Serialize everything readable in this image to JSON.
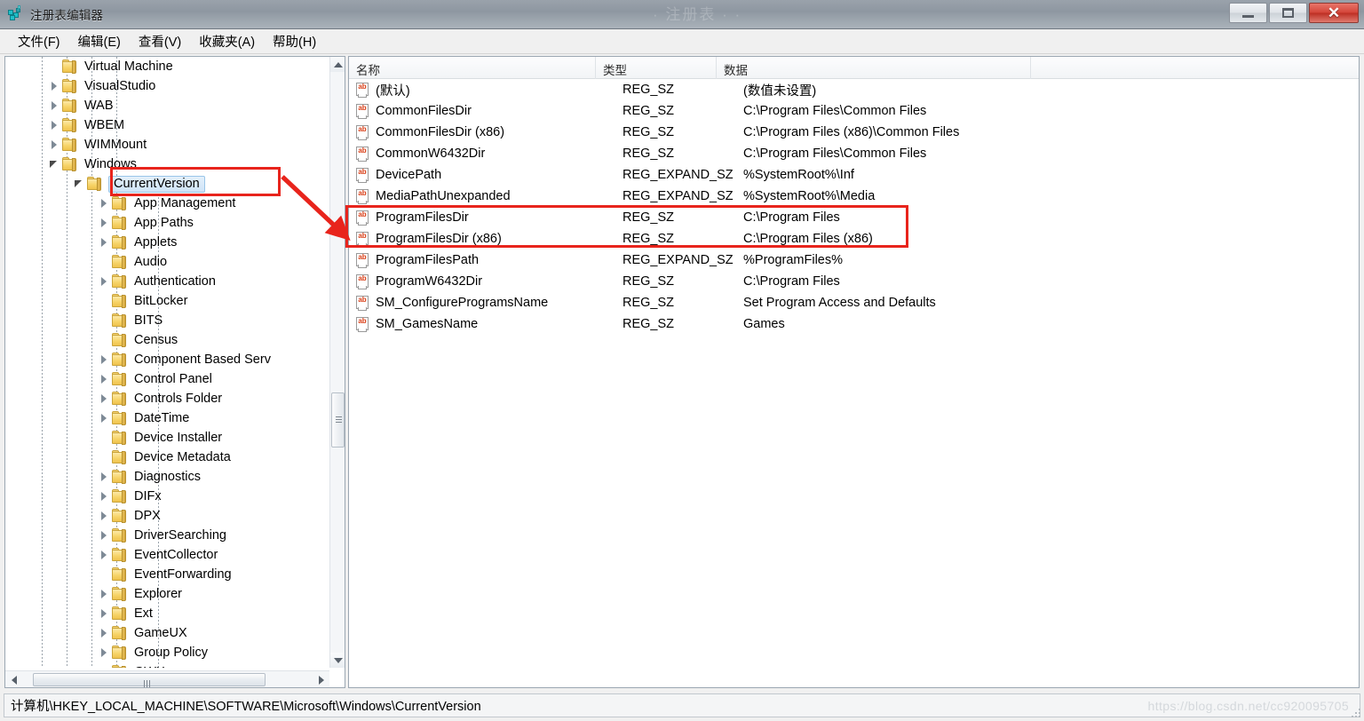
{
  "window": {
    "title": "注册表编辑器",
    "icon": "registry-editor-icon",
    "minimize_label": "",
    "maximize_label": "",
    "close_label": "✕",
    "title_watermark": "· 注册表 · ·"
  },
  "menubar": {
    "items": [
      {
        "label": "文件(F)",
        "name": "menu-file"
      },
      {
        "label": "编辑(E)",
        "name": "menu-edit"
      },
      {
        "label": "查看(V)",
        "name": "menu-view"
      },
      {
        "label": "收藏夹(A)",
        "name": "menu-favorites"
      },
      {
        "label": "帮助(H)",
        "name": "menu-help"
      }
    ]
  },
  "tree": {
    "nodes": [
      {
        "label": "Virtual Machine",
        "indent": 3,
        "expander": "none",
        "selected": false
      },
      {
        "label": "VisualStudio",
        "indent": 3,
        "expander": "collapsed",
        "selected": false
      },
      {
        "label": "WAB",
        "indent": 3,
        "expander": "collapsed",
        "selected": false
      },
      {
        "label": "WBEM",
        "indent": 3,
        "expander": "collapsed",
        "selected": false
      },
      {
        "label": "WIMMount",
        "indent": 3,
        "expander": "collapsed",
        "selected": false
      },
      {
        "label": "Windows",
        "indent": 3,
        "expander": "expanded",
        "selected": false
      },
      {
        "label": "CurrentVersion",
        "indent": 4,
        "expander": "expanded",
        "selected": true
      },
      {
        "label": "App Management",
        "indent": 5,
        "expander": "collapsed",
        "selected": false
      },
      {
        "label": "App Paths",
        "indent": 5,
        "expander": "collapsed",
        "selected": false
      },
      {
        "label": "Applets",
        "indent": 5,
        "expander": "collapsed",
        "selected": false
      },
      {
        "label": "Audio",
        "indent": 5,
        "expander": "none",
        "selected": false
      },
      {
        "label": "Authentication",
        "indent": 5,
        "expander": "collapsed",
        "selected": false
      },
      {
        "label": "BitLocker",
        "indent": 5,
        "expander": "none",
        "selected": false
      },
      {
        "label": "BITS",
        "indent": 5,
        "expander": "none",
        "selected": false
      },
      {
        "label": "Census",
        "indent": 5,
        "expander": "none",
        "selected": false
      },
      {
        "label": "Component Based Serv",
        "indent": 5,
        "expander": "collapsed",
        "selected": false
      },
      {
        "label": "Control Panel",
        "indent": 5,
        "expander": "collapsed",
        "selected": false
      },
      {
        "label": "Controls Folder",
        "indent": 5,
        "expander": "collapsed",
        "selected": false
      },
      {
        "label": "DateTime",
        "indent": 5,
        "expander": "collapsed",
        "selected": false
      },
      {
        "label": "Device Installer",
        "indent": 5,
        "expander": "none",
        "selected": false
      },
      {
        "label": "Device Metadata",
        "indent": 5,
        "expander": "none",
        "selected": false
      },
      {
        "label": "Diagnostics",
        "indent": 5,
        "expander": "collapsed",
        "selected": false
      },
      {
        "label": "DIFx",
        "indent": 5,
        "expander": "collapsed",
        "selected": false
      },
      {
        "label": "DPX",
        "indent": 5,
        "expander": "collapsed",
        "selected": false
      },
      {
        "label": "DriverSearching",
        "indent": 5,
        "expander": "collapsed",
        "selected": false
      },
      {
        "label": "EventCollector",
        "indent": 5,
        "expander": "collapsed",
        "selected": false
      },
      {
        "label": "EventForwarding",
        "indent": 5,
        "expander": "none",
        "selected": false
      },
      {
        "label": "Explorer",
        "indent": 5,
        "expander": "collapsed",
        "selected": false
      },
      {
        "label": "Ext",
        "indent": 5,
        "expander": "collapsed",
        "selected": false
      },
      {
        "label": "GameUX",
        "indent": 5,
        "expander": "collapsed",
        "selected": false
      },
      {
        "label": "Group Policy",
        "indent": 5,
        "expander": "collapsed",
        "selected": false
      },
      {
        "label": "GWX",
        "indent": 5,
        "expander": "none",
        "selected": false
      }
    ]
  },
  "list": {
    "columns": [
      {
        "label": "名称",
        "name": "column-name"
      },
      {
        "label": "类型",
        "name": "column-type"
      },
      {
        "label": "数据",
        "name": "column-data"
      }
    ],
    "rows": [
      {
        "name": "(默认)",
        "type": "REG_SZ",
        "data": "(数值未设置)",
        "highlighted": false
      },
      {
        "name": "CommonFilesDir",
        "type": "REG_SZ",
        "data": "C:\\Program Files\\Common Files",
        "highlighted": false
      },
      {
        "name": "CommonFilesDir (x86)",
        "type": "REG_SZ",
        "data": "C:\\Program Files (x86)\\Common Files",
        "highlighted": false
      },
      {
        "name": "CommonW6432Dir",
        "type": "REG_SZ",
        "data": "C:\\Program Files\\Common Files",
        "highlighted": false
      },
      {
        "name": "DevicePath",
        "type": "REG_EXPAND_SZ",
        "data": "%SystemRoot%\\Inf",
        "highlighted": false
      },
      {
        "name": "MediaPathUnexpanded",
        "type": "REG_EXPAND_SZ",
        "data": "%SystemRoot%\\Media",
        "highlighted": false
      },
      {
        "name": "ProgramFilesDir",
        "type": "REG_SZ",
        "data": "C:\\Program Files",
        "highlighted": true
      },
      {
        "name": "ProgramFilesDir (x86)",
        "type": "REG_SZ",
        "data": "C:\\Program Files (x86)",
        "highlighted": true
      },
      {
        "name": "ProgramFilesPath",
        "type": "REG_EXPAND_SZ",
        "data": "%ProgramFiles%",
        "highlighted": false
      },
      {
        "name": "ProgramW6432Dir",
        "type": "REG_SZ",
        "data": "C:\\Program Files",
        "highlighted": false
      },
      {
        "name": "SM_ConfigureProgramsName",
        "type": "REG_SZ",
        "data": "Set Program Access and Defaults",
        "highlighted": false
      },
      {
        "name": "SM_GamesName",
        "type": "REG_SZ",
        "data": "Games",
        "highlighted": false
      }
    ]
  },
  "annotations": {
    "accent_color": "#e8241c",
    "tree_box_target": "CurrentVersion",
    "list_box_target": "ProgramFilesDir rows",
    "arrow": "red-arrow-pointing-to-program-files-rows"
  },
  "statusbar": {
    "path": "计算机\\HKEY_LOCAL_MACHINE\\SOFTWARE\\Microsoft\\Windows\\CurrentVersion",
    "watermark": "https://blog.csdn.net/cc920095705"
  }
}
